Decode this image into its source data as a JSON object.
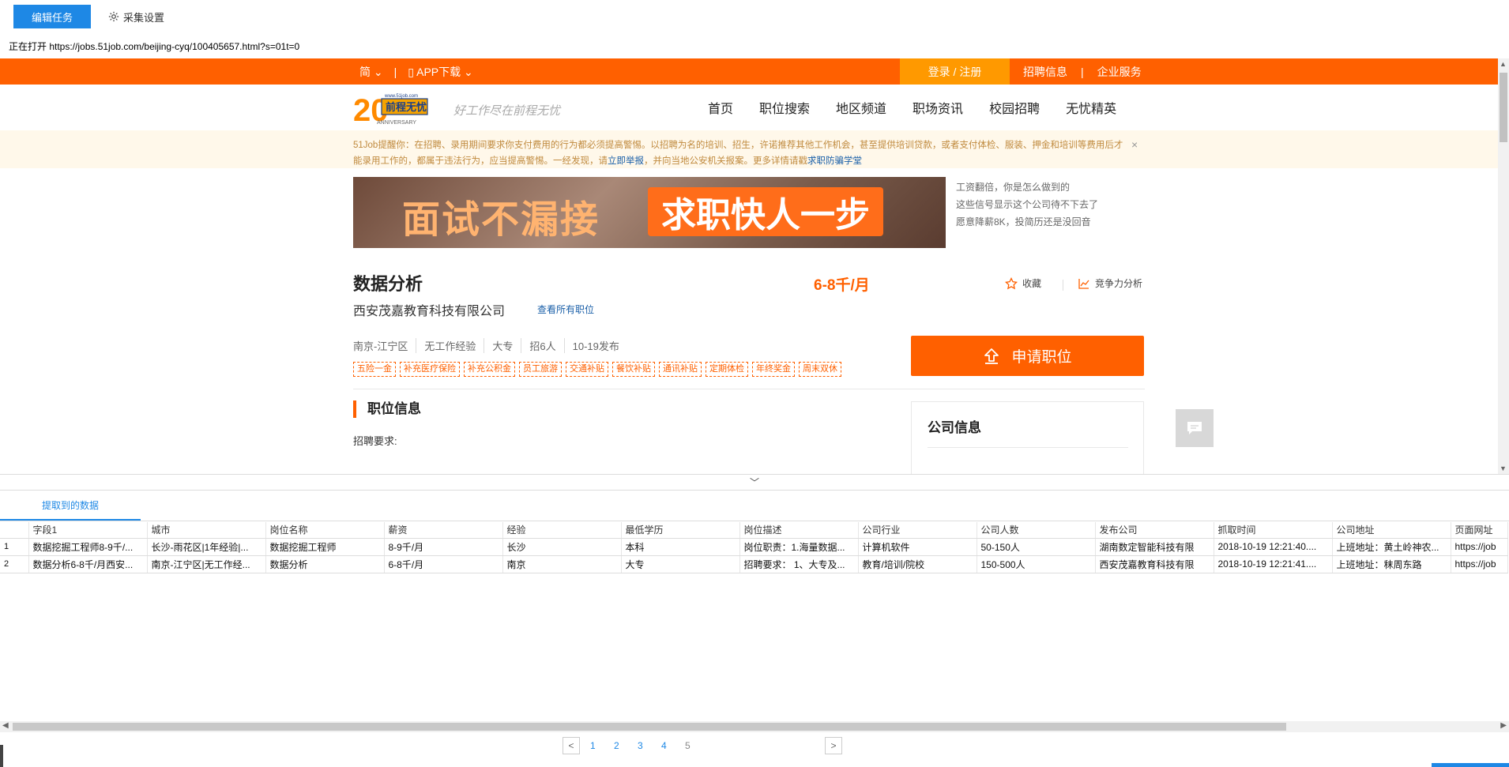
{
  "toolbar": {
    "edit_task": "编辑任务",
    "collect_settings": "采集设置"
  },
  "status": {
    "opening": "正在打开 https://jobs.51job.com/beijing-cyq/100405657.html?s=01t=0"
  },
  "site": {
    "topbar": {
      "lang": "简",
      "sep": "|",
      "app_download": "APP下载",
      "login": "登录 / 注册",
      "recruit_info": "招聘信息",
      "enterprise": "企业服务"
    },
    "logo": {
      "num": "20",
      "brand": "前程无忧",
      "url": "www.51job.com",
      "anniv": "ANNIVERSARY"
    },
    "slogan": "好工作尽在前程无忧",
    "nav": [
      "首页",
      "职位搜索",
      "地区频道",
      "职场资讯",
      "校园招聘",
      "无忧精英"
    ],
    "notice": {
      "part1": "51Job提醒你：在招聘、录用期间要求你支付费用的行为都必须提高警惕。以招聘为名的培训、招生，许诺推荐其他工作机会，甚至提供培训贷款，或者支付体检、服装、押金和培训等费用后才能录用工作的，都属于违法行为，应当提高警惕。一经发现，请",
      "link1": "立即举报",
      "part2": "，并向当地公安机关报案。更多详情请戳",
      "link2": "求职防骗学堂",
      "close": "×"
    },
    "banner": {
      "left": "面试不漏接",
      "right": "求职快人一步"
    },
    "side_links": [
      "工资翻倍，你是怎么做到的",
      "这些信号显示这个公司待不下去了",
      "愿意降薪8K，投简历还是没回音"
    ],
    "job": {
      "title": "数据分析",
      "salary": "6-8千/月",
      "favorite": "收藏",
      "compete": "竞争力分析",
      "company": "西安茂嘉教育科技有限公司",
      "all_jobs": "查看所有职位",
      "meta": [
        "南京-江宁区",
        "无工作经验",
        "大专",
        "招6人",
        "10-19发布"
      ],
      "tags": [
        "五险一金",
        "补充医疗保险",
        "补充公积金",
        "员工旅游",
        "交通补贴",
        "餐饮补贴",
        "通讯补贴",
        "定期体检",
        "年终奖金",
        "周末双休"
      ],
      "apply": "申请职位",
      "section_title": "职位信息",
      "requirements": "招聘要求:",
      "company_info": "公司信息"
    }
  },
  "panel": {
    "tab": "提取到的数据",
    "columns": [
      "",
      "字段1",
      "城市",
      "岗位名称",
      "薪资",
      "经验",
      "最低学历",
      "岗位描述",
      "公司行业",
      "公司人数",
      "发布公司",
      "抓取时间",
      "公司地址",
      "页面网址"
    ],
    "rows": [
      [
        "1",
        "数据挖掘工程师8-9千/...",
        "长沙-雨花区|1年经验|...",
        "数据挖掘工程师",
        "8-9千/月",
        "长沙",
        "本科",
        "岗位职责：1.海量数据...",
        "计算机软件",
        "50-150人",
        "湖南数定智能科技有限",
        "2018-10-19 12:21:40....",
        "上班地址：黄土岭神农...",
        "https://job"
      ],
      [
        "2",
        "数据分析6-8千/月西安...",
        "南京-江宁区|无工作经...",
        "数据分析",
        "6-8千/月",
        "南京",
        "大专",
        "招聘要求： 1、大专及...",
        "教育/培训/院校",
        "150-500人",
        "西安茂嘉教育科技有限",
        "2018-10-19 12:21:41....",
        "上班地址：秣周东路",
        "https://job"
      ]
    ],
    "pages": [
      "1",
      "2",
      "3",
      "4",
      "5"
    ],
    "prev": "<",
    "next": ">"
  }
}
